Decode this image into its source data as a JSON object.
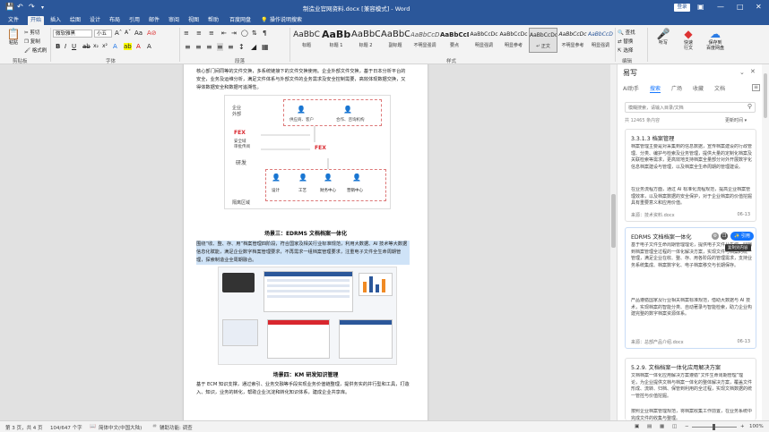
{
  "titlebar": {
    "save_icon": "save-icon",
    "undo_icon": "undo-icon",
    "redo_icon": "redo-icon",
    "title": "制造业官网资料.docx [兼容模式] - Word",
    "login": "登录",
    "ribbon_toggle_icon": "ribbon-display-icon",
    "min_icon": "minimize-icon",
    "max_icon": "maximize-icon",
    "close_icon": "close-icon"
  },
  "menubar": {
    "items": [
      "文件",
      "开始",
      "插入",
      "绘图",
      "设计",
      "布局",
      "引用",
      "邮件",
      "审阅",
      "视图",
      "帮助",
      "百度网盘"
    ],
    "active": "开始",
    "tellme": "操作说明搜索"
  },
  "ribbon": {
    "clipboard": {
      "paste": "粘贴",
      "cut": "剪切",
      "copy": "复制",
      "format_painter": "格式刷",
      "group_label": "剪贴板"
    },
    "font": {
      "name": "微软雅黑",
      "size": "小五",
      "group_label": "字体"
    },
    "paragraph": {
      "group_label": "段落"
    },
    "styles": {
      "items": [
        {
          "preview": "AaBbC",
          "name": "标题"
        },
        {
          "preview": "AaBb",
          "name": "标题 1"
        },
        {
          "preview": "AaBbC",
          "name": "标题 2"
        },
        {
          "preview": "AaBbC",
          "name": "副标题"
        },
        {
          "preview": "AaBbCcDc",
          "name": "不明显强调"
        },
        {
          "preview": "AaBbCcD",
          "name": "要点"
        },
        {
          "preview": "AaBbCcDc",
          "name": "明显强调"
        },
        {
          "preview": "AaBbCcDc",
          "name": "明显参考"
        },
        {
          "preview": "AaBbCcDd",
          "name": "↵ 正文"
        },
        {
          "preview": "AaBbCcDc",
          "name": "不明显参考"
        },
        {
          "preview": "AaBbCcDc",
          "name": "明显强调"
        }
      ],
      "group_label": "样式"
    },
    "editing": {
      "find": "查找",
      "replace": "替换",
      "select": "选择",
      "group_label": "编辑"
    },
    "extra": {
      "dictate": "听写",
      "flash": "快速\n行文",
      "private_cloud": "保存到\n百度网盘",
      "gu_label": "创建\n并共享\nAdobe PDF"
    }
  },
  "document": {
    "para1": "核心部门间同等的文件交换，多系统链接下的文件交换使用。企业外部文件交换，基于日本分析平台的安全，业务及运维分析，满足文件体系与外部文件的业务需求及安全控制需要，高效体现数据交换，又得体数据安全和数据可追溯性。",
    "diagram_labels": {
      "outside": "企业\n外部",
      "supplier": "供应商、客户",
      "partner": "合作、咨询机构",
      "fex1": "FEX",
      "fex2": "FEX",
      "security": "安全域\n审批传阅",
      "rd": "研发",
      "r1": "设计",
      "r2": "工艺",
      "r3": "财务中心",
      "r4": "营销中心",
      "isolation": "隔离区域",
      "platform": "文件文档管理平台"
    },
    "scene3_title": "场景三：EDRMS 文档档案一体化",
    "para2": "围绕“收、整、存、用”档案管理四阶段，符合国家及相关行业标准规范，利用大数据、AI 技术等大数据信息化赋能，满足企业数字档案管理要求，不再需求一组档案管理要求，注重电子文件全生命周期管理，探索制造业全周期融合。",
    "scene4_title": "场景四：KM 研发知识管理",
    "para3": "基于 ECM 知识支撑，通过索引、业务交融等手段实现业务价值链整理，提供务实的并行型和工具，打造入、知识，业务的转化，帮助企业沉淀和转化知识体系，建成企业共享库。"
  },
  "pane": {
    "title": "易写",
    "tabs": [
      "AI助手",
      "搜索",
      "广场",
      "收藏",
      "文档"
    ],
    "active_tab": "搜索",
    "search_placeholder": "模糊搜索，请输入目录/文档",
    "result_count": "共 12465 条内容",
    "sort": "更新时间",
    "cards": [
      {
        "title": "3.3.1.3 档案管理",
        "body": "档案管理主要是对采集到的信息数据，宣传档案建设的行政管理、分类、编护与检索及业务管理，提供大量的定制化档案及关联检索等需求，更高效地支持档案全量部分对外开展数字化信息档案建设与管理，以及档案全生命周期的管理建设。",
        "body2": "在业务流程方面，通过 AI 标准化流程规范，提高企业档案管理效率，以及档案数据的安全保护，对于企业档案的价值挖掘具有重要意义和应用价值。",
        "source": "来源：技术资料.docx",
        "date": "06-13"
      },
      {
        "title": "EDRMS 文档档案一体化",
        "body": "基于电子文件生命周期管理理论，提供电子文件从生成、归档到档案管理全过程的一体化解决方案，实现文件与档案的统一管理，满足企业在收、整、存、用各阶段的管理需求，支持业务系统集成、档案数字化、电子档案移交与长期保存。",
        "body2": "产品遵循国家及行业相关档案标准规范，借助大数据与 AI 技术，实现档案的智能分类、自动著录与智能检索，助力企业构建完整的数字档案资源体系。",
        "source": "来源：总部产品介绍.docx",
        "date": "06-13",
        "btn": "引用",
        "tooltip": "复制到内容"
      },
      {
        "title": "5.2.9. 文档档案一体化应用解决方案",
        "body": "文档档案一体化应用解决方案遵循“文件生命周期管理”理论，为企业提供文档与档案一体化的整体解决方案，覆盖文件形成、流转、归档、保管到利用的全过程，实现文档数据的统一管控与价值挖掘。",
        "body2": "按照企业档案管理规范，将档案收集工作前置，在业务系统中完成文件的收集与整理。",
        "source": "",
        "date": ""
      }
    ]
  },
  "statusbar": {
    "page": "第 3 页，共 4 页",
    "words": "104/647 个字",
    "lang": "简体中文(中国大陆)",
    "accessibility": "辅助功能: 调查",
    "zoom": "100%"
  },
  "colors": {
    "brand": "#2b579a",
    "highlight": "#cfe3f7",
    "accent": "#1677ff",
    "fex": "#d9272e"
  }
}
